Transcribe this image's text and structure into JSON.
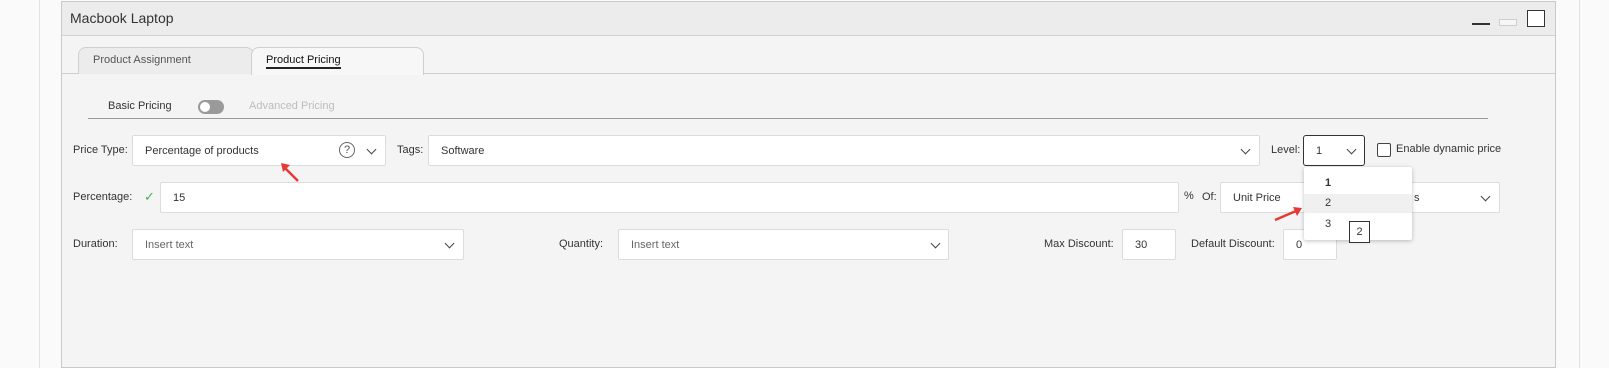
{
  "window": {
    "title": "Macbook Laptop"
  },
  "tabs": [
    {
      "label": "Product Assignment",
      "active": false
    },
    {
      "label": "Product Pricing",
      "active": true
    }
  ],
  "pricing_mode": {
    "basic_label": "Basic Pricing",
    "advanced_label": "Advanced Pricing",
    "advanced_enabled": false
  },
  "price_type": {
    "label": "Price Type:",
    "value": "Percentage of products",
    "help_glyph": "?"
  },
  "tags": {
    "label": "Tags:",
    "value": "Software"
  },
  "level": {
    "label": "Level:",
    "value": "1",
    "options": [
      "1",
      "2",
      "3"
    ],
    "hovered_option": "2",
    "tooltip": "2"
  },
  "dynamic_price": {
    "label": "Enable dynamic price",
    "checked": false
  },
  "percentage": {
    "label": "Percentage:",
    "value": "15",
    "unit": "%",
    "valid_icon": "check-icon"
  },
  "of": {
    "label": "Of:",
    "value": "Unit Price",
    "partial_value": "s"
  },
  "duration": {
    "label": "Duration:",
    "placeholder": "Insert text"
  },
  "quantity": {
    "label": "Quantity:",
    "placeholder": "Insert text"
  },
  "max_discount": {
    "label": "Max Discount:",
    "value": "30"
  },
  "default_discount": {
    "label": "Default Discount:",
    "value": "0"
  },
  "colors": {
    "accent_arrow": "#e53935",
    "check_green": "#4caf50"
  }
}
